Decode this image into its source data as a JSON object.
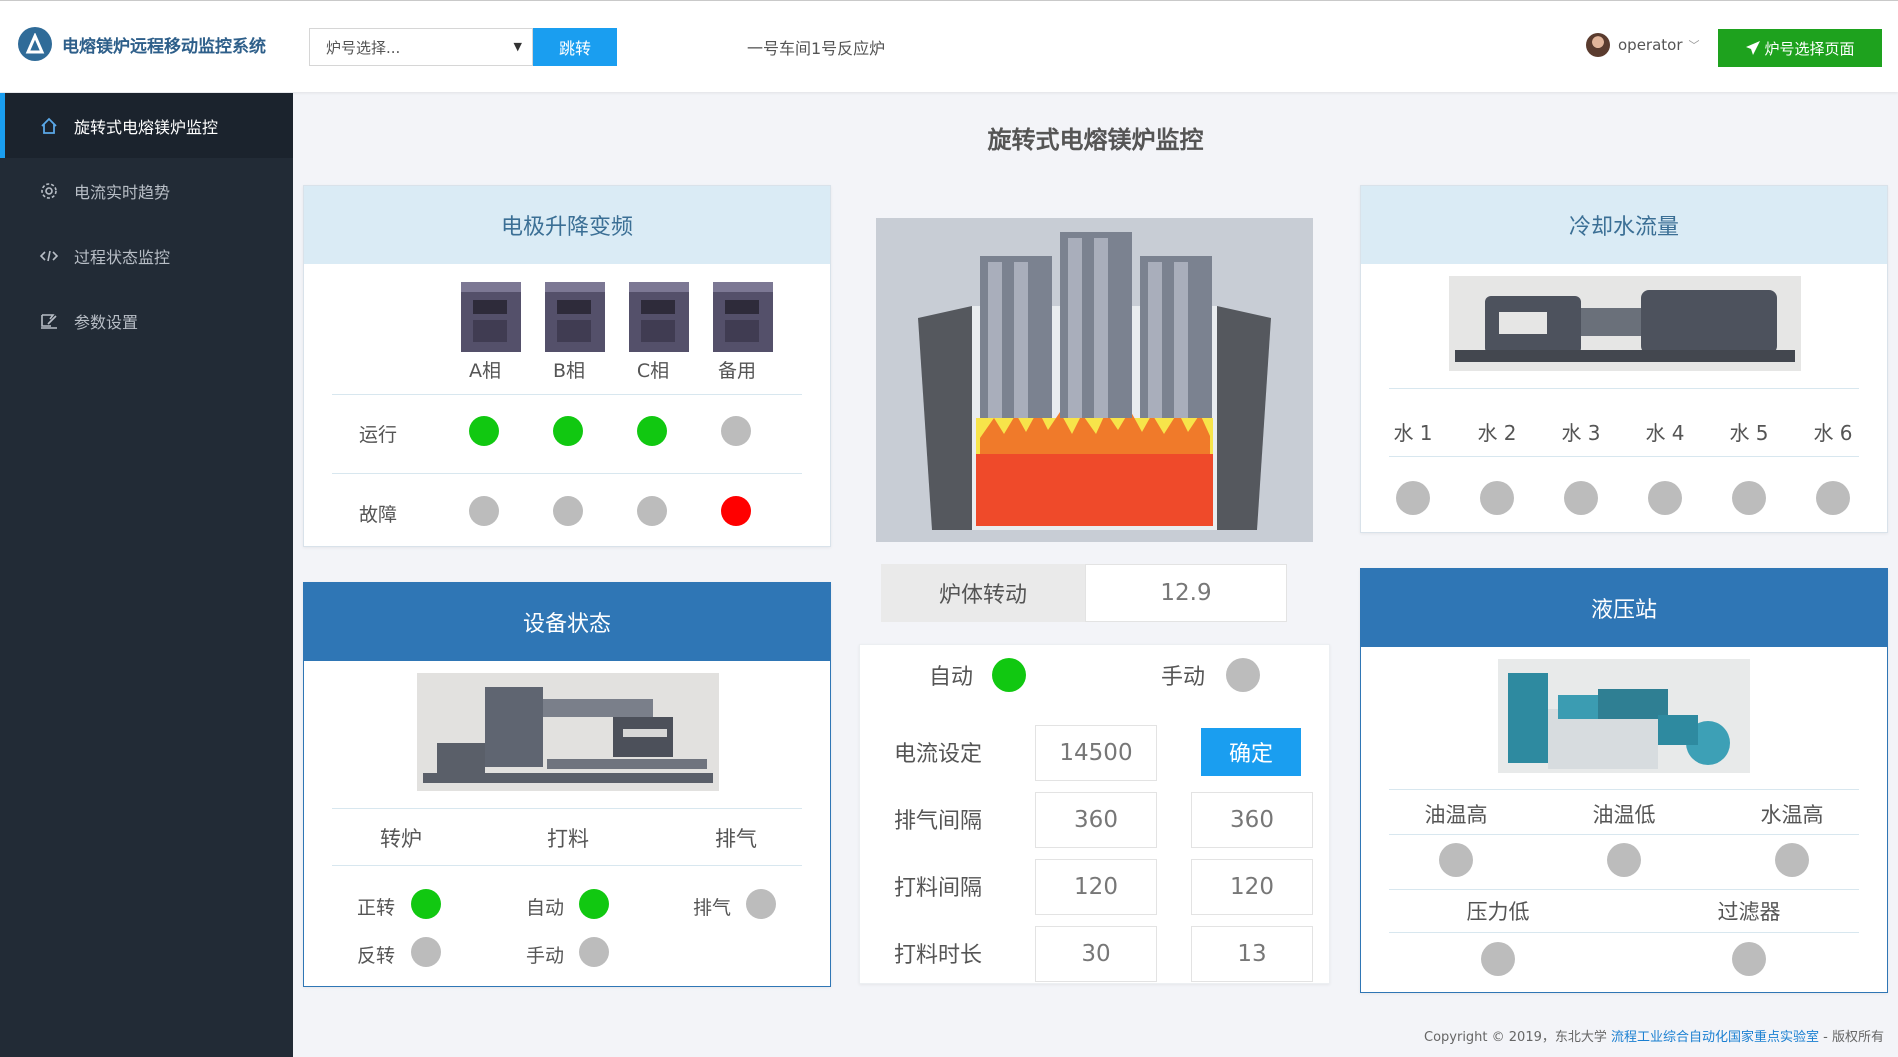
{
  "header": {
    "app_title": "电熔镁炉远程移动监控系统",
    "furnace_select_placeholder": "炉号选择...",
    "jump_button": "跳转",
    "workshop_label": "一号车间1号反应炉",
    "username": "operator",
    "furnace_page_button": "炉号选择页面"
  },
  "sidebar": {
    "items": [
      {
        "label": "旋转式电熔镁炉监控",
        "icon": "home-icon",
        "active": true
      },
      {
        "label": "电流实时趋势",
        "icon": "gear-icon"
      },
      {
        "label": "过程状态监控",
        "icon": "code-icon"
      },
      {
        "label": "参数设置",
        "icon": "edit-icon"
      }
    ]
  },
  "main": {
    "title": "旋转式电熔镁炉监控"
  },
  "electrode": {
    "title": "电极升降变频",
    "phases": [
      "A相",
      "B相",
      "C相",
      "备用"
    ],
    "row_running": "运行",
    "row_fault": "故障",
    "running_status": [
      "green",
      "green",
      "green",
      "gray"
    ],
    "fault_status": [
      "gray",
      "gray",
      "gray",
      "red"
    ]
  },
  "device_status": {
    "title": "设备状态",
    "columns": [
      "转炉",
      "打料",
      "排气"
    ],
    "forward": "正转",
    "reverse": "反转",
    "auto": "自动",
    "manual": "手动",
    "exhaust": "排气",
    "forward_status": "green",
    "reverse_status": "gray",
    "auto_status": "green",
    "manual_status": "gray",
    "exhaust_status": "gray"
  },
  "furnace": {
    "rotation_label": "炉体转动",
    "rotation_value": "12.9",
    "auto_label": "自动",
    "manual_label": "手动",
    "auto_status": "green",
    "manual_status": "gray",
    "params": [
      {
        "label": "电流设定",
        "value": "14500",
        "value2": ""
      },
      {
        "label": "排气间隔",
        "value": "360",
        "value2": "360"
      },
      {
        "label": "打料间隔",
        "value": "120",
        "value2": "120"
      },
      {
        "label": "打料时长",
        "value": "30",
        "value2": "13"
      }
    ],
    "confirm_button": "确定"
  },
  "cooling": {
    "title": "冷却水流量",
    "channels": [
      "水 1",
      "水 2",
      "水 3",
      "水 4",
      "水 5",
      "水 6"
    ]
  },
  "hydraulic": {
    "title": "液压站",
    "row1": [
      "油温高",
      "油温低",
      "水温高"
    ],
    "row2": [
      "压力低",
      "过滤器"
    ]
  },
  "colors": {
    "accent": "#1a9ef0",
    "sidebar_bg": "#222b36",
    "status_green": "#11c811",
    "status_gray": "#bcbcbc",
    "status_red": "#ff0000",
    "panel_head_light": "#daebf5",
    "panel_head_dark": "#2f76b5",
    "button_green": "#1ea21e"
  },
  "footer": {
    "prefix": "Copyright © 2019，东北大学 ",
    "link": "流程工业综合自动化国家重点实验室",
    "suffix": " - 版权所有"
  }
}
